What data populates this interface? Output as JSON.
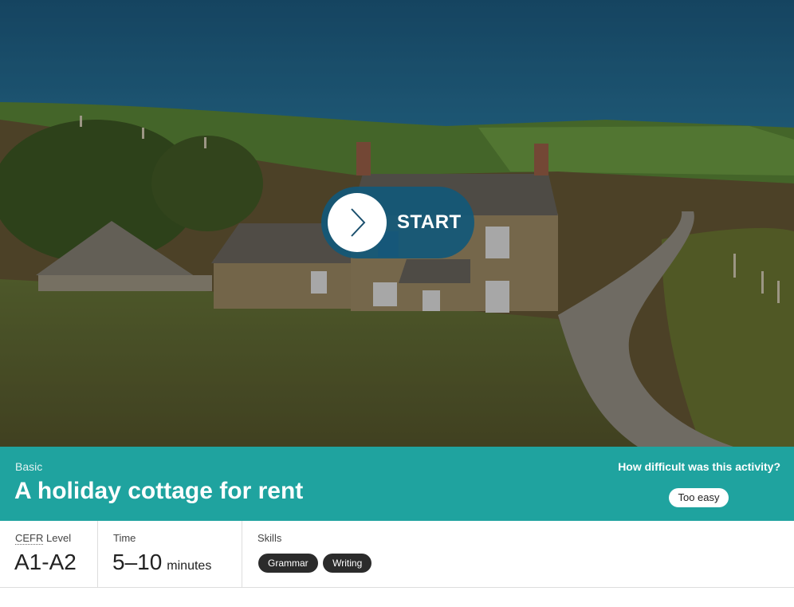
{
  "hero": {
    "start_label": "START"
  },
  "activity": {
    "level": "Basic",
    "title": "A holiday cottage for rent",
    "difficulty_question": "How difficult was this activity?",
    "difficulty_option": "Too easy"
  },
  "info": {
    "cefr_abbr": "CEFR",
    "cefr_label_rest": " Level",
    "cefr_value": "A1-A2",
    "time_label": "Time",
    "time_value": "5–10",
    "time_unit": "minutes",
    "skills_label": "Skills",
    "skills": [
      "Grammar",
      "Writing"
    ]
  },
  "colors": {
    "band": "#1fa39f",
    "start_button": "#125878",
    "chip": "#2b2b2b"
  }
}
